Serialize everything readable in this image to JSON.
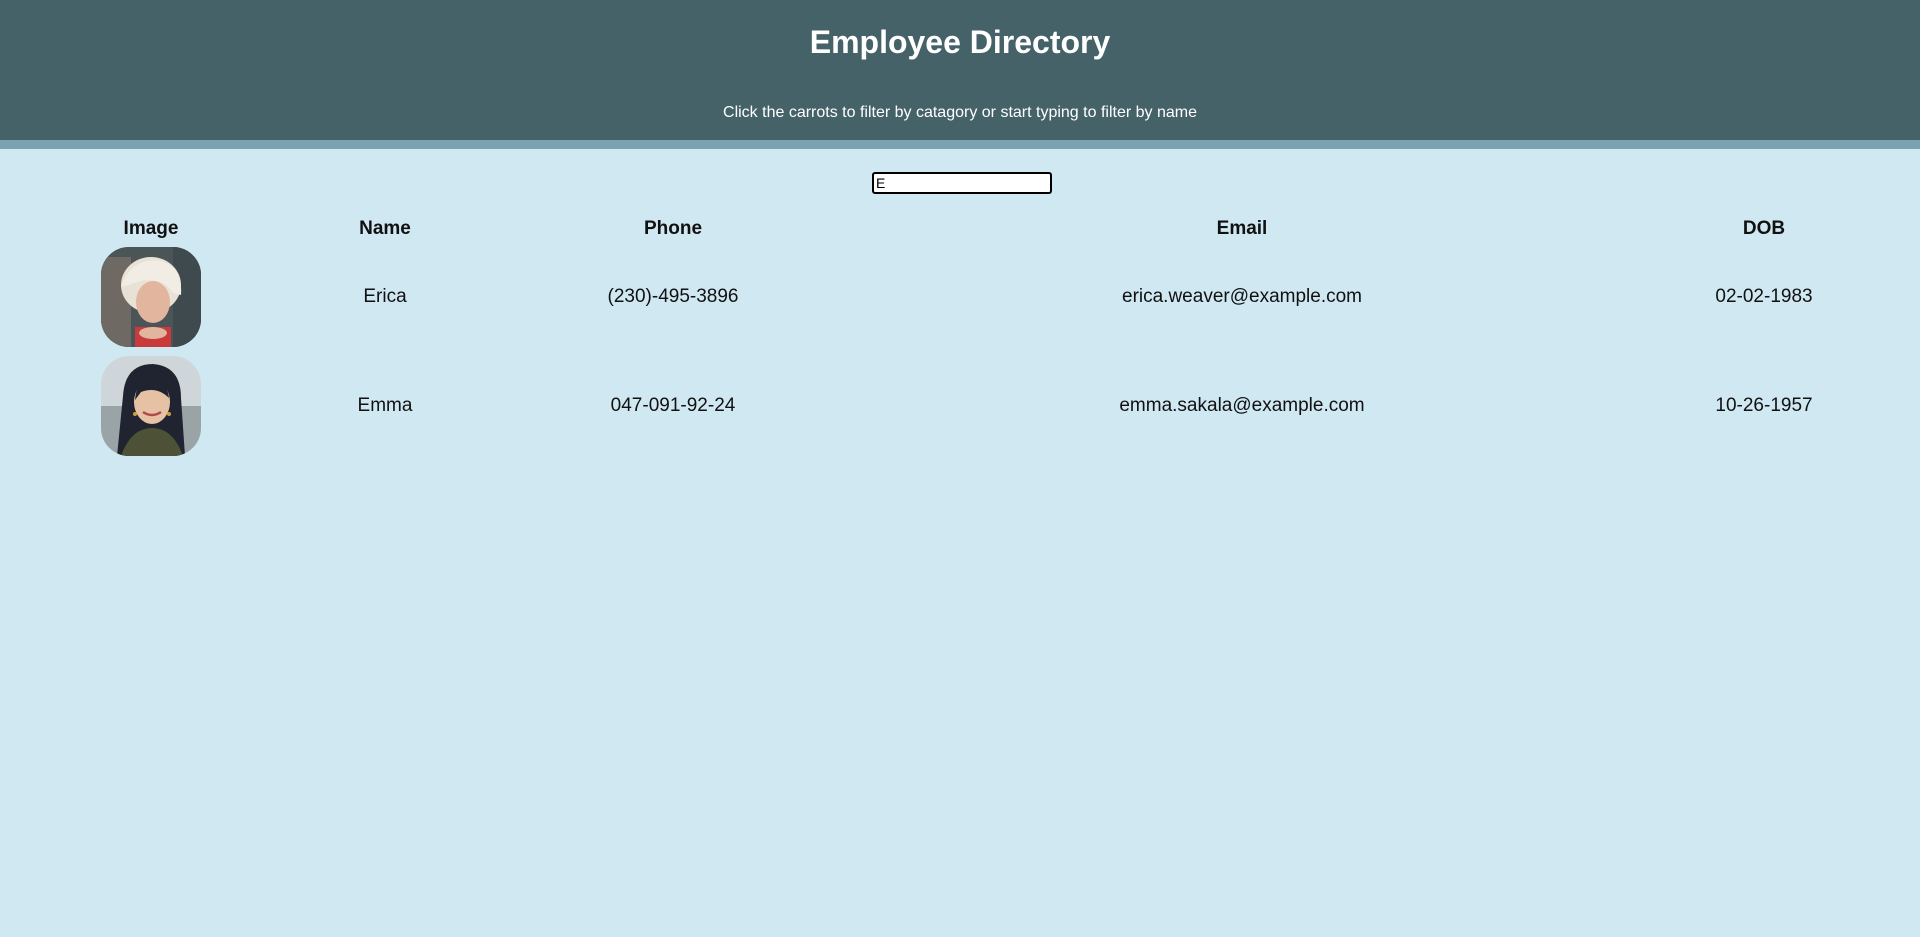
{
  "header": {
    "title": "Employee Directory",
    "subtitle": "Click the carrots to filter by catagory or start typing to filter by name"
  },
  "search": {
    "value": "E"
  },
  "table": {
    "columns": [
      "Image",
      "Name",
      "Phone",
      "Email",
      "DOB"
    ],
    "rows": [
      {
        "image": "avatar-photo-erica",
        "name": "Erica",
        "phone": "(230)-495-3896",
        "email": "erica.weaver@example.com",
        "dob": "02-02-1983"
      },
      {
        "image": "avatar-photo-emma",
        "name": "Emma",
        "phone": "047-091-92-24",
        "email": "emma.sakala@example.com",
        "dob": "10-26-1957"
      }
    ]
  },
  "colors": {
    "header_bg": "#456268",
    "header_border": "#79a3b1",
    "page_bg": "#d0e8f2"
  }
}
